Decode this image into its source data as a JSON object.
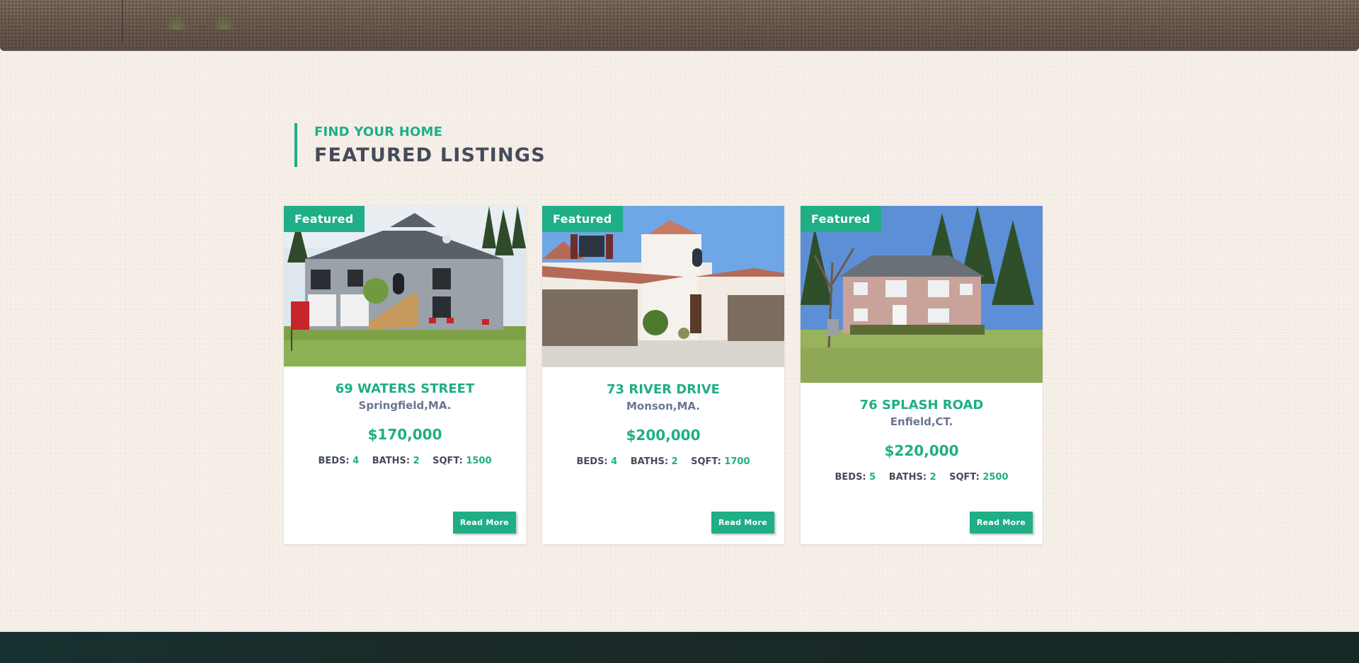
{
  "section": {
    "kicker": "FIND YOUR HOME",
    "title": "FEATURED LISTINGS"
  },
  "listings": [
    {
      "badge": "Featured",
      "address": "69 WATERS STREET",
      "city": "Springfield,MA.",
      "price": "$170,000",
      "beds_label": "BEDS:",
      "beds": "4",
      "baths_label": "BATHS:",
      "baths": "2",
      "sqft_label": "SQFT:",
      "sqft": "1500",
      "button": "Read More"
    },
    {
      "badge": "Featured",
      "address": "73 RIVER DRIVE",
      "city": "Monson,MA.",
      "price": "$200,000",
      "beds_label": "BEDS:",
      "beds": "4",
      "baths_label": "BATHS:",
      "baths": "2",
      "sqft_label": "SQFT:",
      "sqft": "1700",
      "button": "Read More"
    },
    {
      "badge": "Featured",
      "address": "76 SPLASH ROAD",
      "city": "Enfield,CT.",
      "price": "$220,000",
      "beds_label": "BEDS:",
      "beds": "5",
      "baths_label": "BATHS:",
      "baths": "2",
      "sqft_label": "SQFT:",
      "sqft": "2500",
      "button": "Read More"
    }
  ],
  "colors": {
    "accent": "#1fae86",
    "heading": "#454b5a",
    "subtext": "#6a7690",
    "background": "#f6efe8",
    "footer": "#172a28"
  }
}
